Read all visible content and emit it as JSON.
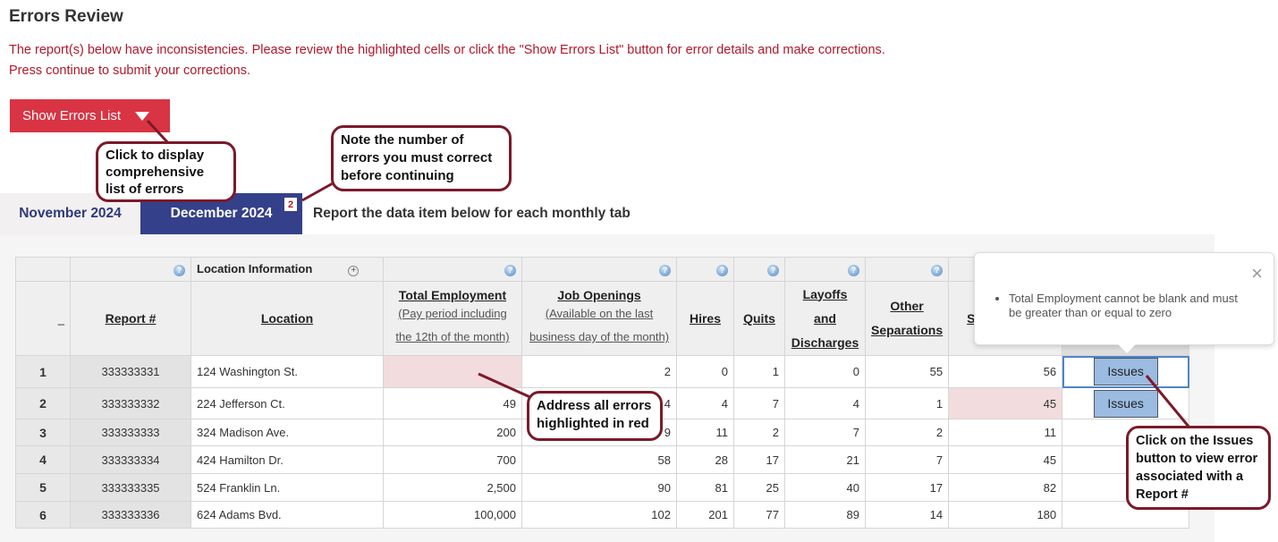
{
  "title": "Errors Review",
  "intro": "The report(s) below have inconsistencies. Please review the highlighted cells or click the \"Show Errors List\" button for error details and make corrections. Press continue to submit your corrections.",
  "show_errors_label": "Show Errors List",
  "tabs": [
    {
      "label": "November 2024"
    },
    {
      "label": "December 2024",
      "error_count": "2"
    }
  ],
  "tab_note": "Report the data item below for each monthly tab",
  "table": {
    "group_header": "Location Information",
    "headers": {
      "row_col": "_",
      "report": "Report #",
      "location": "Location",
      "total_emp": "Total Employment",
      "total_emp_sub1": "(Pay period including",
      "total_emp_sub2": "the 12th of the month)",
      "job_open": "Job Openings",
      "job_open_sub1": "(Available on the last",
      "job_open_sub2": "business day of the month)",
      "hires": "Hires",
      "quits": "Quits",
      "layoffs1": "Layoffs and",
      "layoffs2": "Discharges",
      "other1": "Other",
      "other2": "Separations",
      "sep_partial": "S"
    },
    "rows": [
      {
        "n": "1",
        "report": "333333331",
        "location": "124 Washington St.",
        "total_emp": "",
        "job_open": "2",
        "hires": "0",
        "quits": "1",
        "layoffs": "0",
        "other": "55",
        "sep": "56",
        "issues": "Issues"
      },
      {
        "n": "2",
        "report": "333333332",
        "location": "224 Jefferson Ct.",
        "total_emp": "49",
        "job_open": "4",
        "hires": "4",
        "quits": "7",
        "layoffs": "4",
        "other": "1",
        "sep": "45",
        "issues": "Issues"
      },
      {
        "n": "3",
        "report": "333333333",
        "location": "324 Madison Ave.",
        "total_emp": "200",
        "job_open": "9",
        "hires": "11",
        "quits": "2",
        "layoffs": "7",
        "other": "2",
        "sep": "11"
      },
      {
        "n": "4",
        "report": "333333334",
        "location": "424 Hamilton Dr.",
        "total_emp": "700",
        "job_open": "58",
        "hires": "28",
        "quits": "17",
        "layoffs": "21",
        "other": "7",
        "sep": "45"
      },
      {
        "n": "5",
        "report": "333333335",
        "location": "524 Franklin Ln.",
        "total_emp": "2,500",
        "job_open": "90",
        "hires": "81",
        "quits": "25",
        "layoffs": "40",
        "other": "17",
        "sep": "82"
      },
      {
        "n": "6",
        "report": "333333336",
        "location": "624 Adams Bvd.",
        "total_emp": "100,000",
        "job_open": "102",
        "hires": "201",
        "quits": "77",
        "layoffs": "89",
        "other": "14",
        "sep": "180"
      }
    ]
  },
  "popup": {
    "message": "Total Employment cannot be blank and must be greater than or equal to zero",
    "close": "×"
  },
  "callouts": {
    "show_list": "Click to display comprehensive list of errors",
    "error_count": "Note the number of errors you must correct before continuing",
    "highlighted": "Address all errors highlighted in red",
    "issues": "Click on the Issues button to view error associated with a Report #"
  },
  "colors": {
    "error_red": "#b0182a",
    "tab_active": "#35408a",
    "button_red": "#d93444",
    "callout_border": "#7b1a2a",
    "error_cell": "#f2dcdd",
    "issues_button": "#9bbbe0"
  }
}
